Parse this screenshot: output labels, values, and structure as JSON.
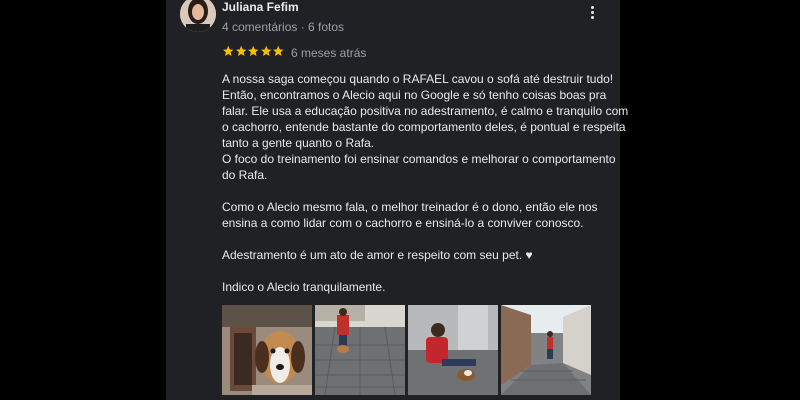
{
  "reviewer": {
    "name": "Juliana Fefim",
    "meta": "4 comentários · 6 fotos"
  },
  "rating": {
    "stars": 5,
    "time": "6 meses atrás",
    "star_color": "#fbbc04"
  },
  "review": {
    "paragraphs": [
      "A nossa saga começou quando o RAFAEL cavou o sofá até destruir tudo! Então, encontramos o Alecio aqui no Google e só tenho coisas boas pra falar. Ele usa a educação positiva no adestramento, é calmo e tranquilo com o cachorro, entende bastante do comportamento deles, é pontual e respeita tanto a gente quanto o Rafa.",
      "O foco do treinamento foi ensinar comandos e melhorar o comportamento do Rafa.",
      "",
      "Como o Alecio mesmo fala, o melhor treinador é o dono, então ele nos ensina a como lidar com o cachorro e ensiná-lo a conviver conosco.",
      "",
      "Adestramento é um ato de amor e respeito com seu pet. ♥",
      "",
      "Indico o Alecio tranquilamente."
    ]
  },
  "photos": [
    {
      "icon": "beagle-photo"
    },
    {
      "icon": "street-walk-photo"
    },
    {
      "icon": "training-photo"
    },
    {
      "icon": "alley-photo"
    }
  ],
  "colors": {
    "panel": "#202124",
    "text": "#e8eaed",
    "secondary": "#9aa0a6"
  }
}
